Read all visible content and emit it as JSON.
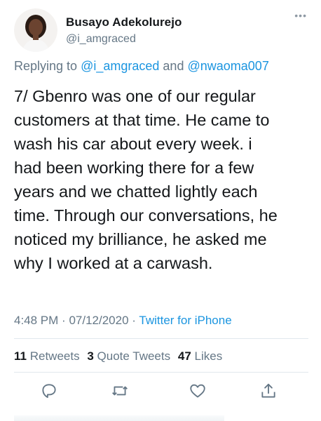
{
  "author": {
    "display_name": "Busayo Adekolurejo",
    "handle": "@i_amgraced"
  },
  "reply": {
    "prefix": "Replying to",
    "mention_1": "@i_amgraced",
    "conjunction": "and",
    "mention_2": "@nwaoma007"
  },
  "tweet": {
    "text": "7/ Gbenro was one of our regular\ncustomers at that time. He came to\nwash his car about every week.  i\nhad been working there for a few\nyears and we chatted lightly each\ntime. Through our conversations, he\nnoticed my brilliance, he asked me\nwhy I worked at a carwash."
  },
  "meta": {
    "time": "4:48 PM",
    "separator": "·",
    "date": "07/12/2020",
    "source": "Twitter for iPhone"
  },
  "stats": {
    "retweets_count": "11",
    "retweets_label": "Retweets",
    "quotes_count": "3",
    "quotes_label": "Quote Tweets",
    "likes_count": "47",
    "likes_label": "Likes"
  },
  "icons": {
    "more": "more-icon",
    "reply": "reply-icon",
    "retweet": "retweet-icon",
    "like": "like-icon",
    "share": "share-icon"
  },
  "colors": {
    "link": "#1b95e0",
    "secondary_text": "#657786",
    "primary_text": "#14171a",
    "divider": "#e1e8ed"
  }
}
